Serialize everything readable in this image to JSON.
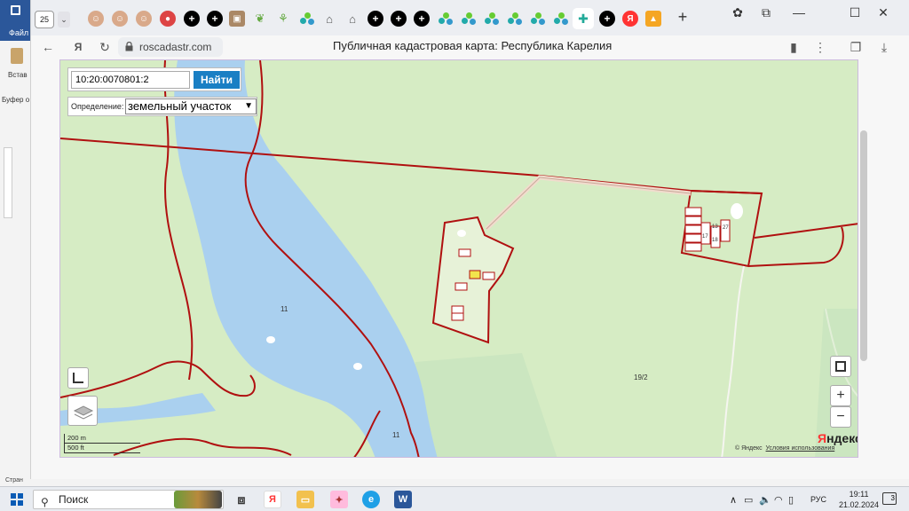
{
  "word": {
    "file_label": "Файл",
    "paste_label": "Встав",
    "clipboard_label": "Буфер о",
    "status_label": "Стран"
  },
  "browser": {
    "tab_count": "25",
    "url": "roscadastr.com",
    "page_title": "Публичная кадастровая карта: Республика Карелия",
    "accent": "#1a7fc4"
  },
  "map": {
    "search_value": "10:20:0070801:2",
    "search_button": "Найти",
    "definition_label": "Определение:",
    "definition_value": "земельный участок",
    "labels": {
      "lake_1": "11",
      "lake_2": "11",
      "plot_19_2": "19/2",
      "plot_17": "17",
      "plot_13": "13",
      "plot_18": "18",
      "plot_27": "27"
    },
    "zoom_in": "+",
    "zoom_out": "−",
    "scale_m": "200 m",
    "scale_ft": "500 ft",
    "yandex_logo_a": "Я",
    "yandex_logo_b": "ндекс",
    "copyright": "© Яндекс",
    "terms": "Условия использования",
    "water_color": "#aad0ef",
    "forest_color": "#d6ecc4",
    "border_color": "#b01010"
  },
  "taskbar": {
    "search_placeholder": "Поиск",
    "language": "РУС",
    "time": "19:11",
    "date": "21.02.2024",
    "notifications": "3"
  }
}
